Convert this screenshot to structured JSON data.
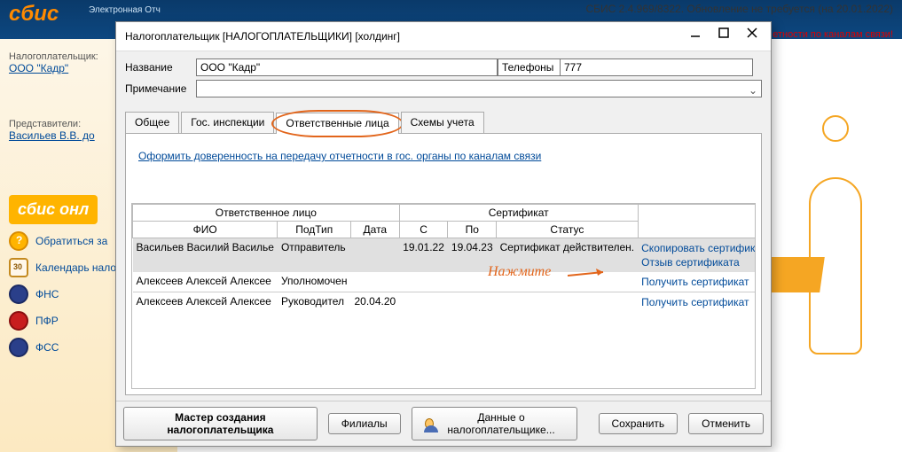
{
  "bg": {
    "logo": "сбис",
    "logo_sub": "Электронная\nОтч",
    "status": "СБИС 2.4.969/8322. Обновление не требуется (на 20.01.2022)",
    "alert": "етности по каналам связи!",
    "left": {
      "taxpayer_label": "Налогоплательщик:",
      "taxpayer_value": "ООО \"Кадр\"",
      "reps_label": "Представители:",
      "reps_value": "Васильев В.В. до",
      "online_logo": "сбис онл",
      "help": "Обратиться за",
      "calendar": "Календарь налогоплате",
      "fns": "ФНС",
      "pfr": "ПФР",
      "fss": "ФСС"
    }
  },
  "modal": {
    "title": "Налогоплательщик [НАЛОГОПЛАТЕЛЬЩИКИ] [холдинг]",
    "labels": {
      "name": "Название",
      "phones": "Телефоны",
      "note": "Примечание"
    },
    "name_value": "ООО \"Кадр\"",
    "phone_value": "777",
    "tabs": [
      "Общее",
      "Гос. инспекции",
      "Ответственные лица",
      "Схемы учета"
    ],
    "link": "Оформить доверенность на передачу отчетности в гос. органы по каналам связи",
    "grid": {
      "group1": "Ответственное лицо",
      "group2": "Сертификат",
      "cols": [
        "ФИО",
        "ПодТип",
        "Дата",
        "С",
        "По",
        "Статус"
      ],
      "rows": [
        {
          "fio": "Васильев Василий Василье",
          "subtype": "Отправитель",
          "date": "",
          "from": "19.01.22",
          "to": "19.04.23",
          "status": "Сертификат действителен.",
          "actions": [
            "Скопировать сертификат",
            "Отзыв сертификата"
          ],
          "selected": true
        },
        {
          "fio": "Алексеев Алексей Алексее",
          "subtype": "Уполномочен",
          "date": "",
          "from": "",
          "to": "",
          "status": "",
          "actions": [
            "Получить сертификат"
          ],
          "selected": false
        },
        {
          "fio": "Алексеев Алексей Алексее",
          "subtype": "Руководител",
          "date": "20.04.20",
          "from": "",
          "to": "",
          "status": "",
          "actions": [
            "Получить сертификат"
          ],
          "selected": false
        }
      ]
    },
    "annotation": "Нажмите",
    "footer": {
      "wizard": "Мастер создания налогоплательщика",
      "branches": "Филиалы",
      "info": "Данные о налогоплательщике...",
      "save": "Сохранить",
      "cancel": "Отменить"
    }
  }
}
